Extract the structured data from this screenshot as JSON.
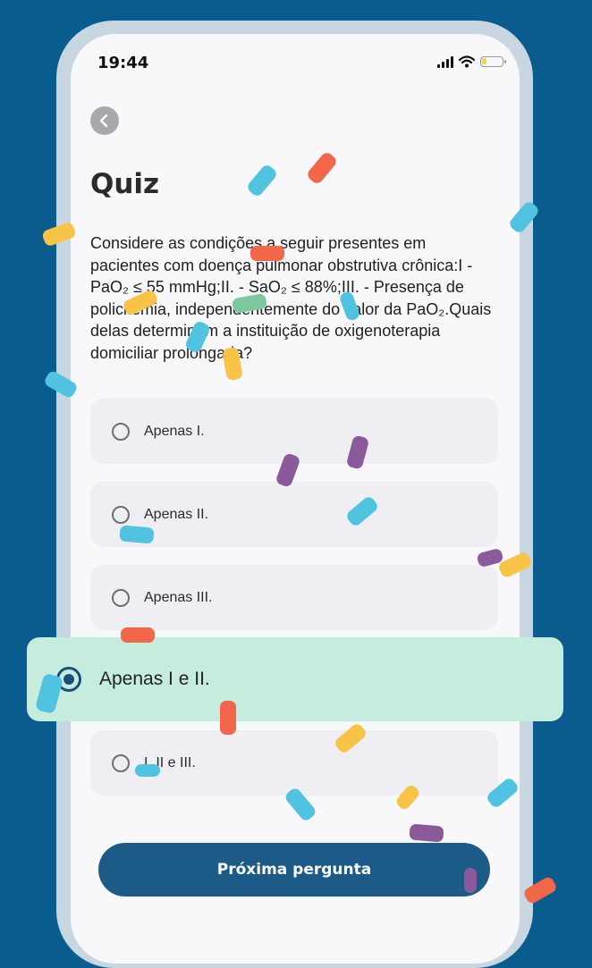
{
  "colors": {
    "background": "#0a5c8f",
    "primary": "#1c5a87",
    "selected_option": "#c5ecdc",
    "confetti": [
      "#4fc3e0",
      "#f2664a",
      "#f7c448",
      "#7ec8a0",
      "#8a5a9a"
    ]
  },
  "status_bar": {
    "time": "19:44",
    "icons": [
      "signal-icon",
      "wifi-icon",
      "battery-icon"
    ],
    "battery_level": 0.25
  },
  "header": {
    "back_icon": "chevron-left-icon",
    "title": "Quiz"
  },
  "question": {
    "text": "Considere as condições a seguir presentes em pacientes com doença pulmonar obstrutiva crônica:I - PaO₂ ≤ 55 mmHg;II. - SaO₂ ≤ 88%;III. - Presença de policitemia, independentemente do valor da PaO₂.Quais delas determinam a instituição de oxigenoterapia domiciliar prolongada?"
  },
  "options": [
    {
      "label": "Apenas I.",
      "selected": false
    },
    {
      "label": "Apenas II.",
      "selected": false
    },
    {
      "label": "Apenas III.",
      "selected": false
    },
    {
      "label": "Apenas I e II.",
      "selected": true
    },
    {
      "label": "I, II e III.",
      "selected": false
    }
  ],
  "next_button": {
    "label": "Próxima pergunta"
  }
}
